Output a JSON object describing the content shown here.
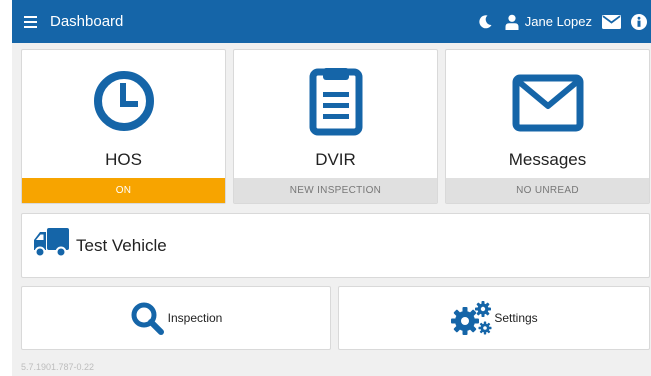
{
  "header": {
    "title": "Dashboard",
    "user_name": "Jane Lopez",
    "icons": [
      "menu-icon",
      "moon-icon",
      "user-icon",
      "mail-icon",
      "info-icon"
    ],
    "bar_color": "#1565a8"
  },
  "tiles": {
    "hos": {
      "label": "HOS",
      "status": "ON",
      "icon": "clock-icon"
    },
    "dvir": {
      "label": "DVIR",
      "status": "NEW INSPECTION",
      "icon": "clipboard-icon"
    },
    "messages": {
      "label": "Messages",
      "status": "NO UNREAD",
      "icon": "envelope-icon"
    }
  },
  "vehicle": {
    "name": "Test Vehicle",
    "icon": "truck-icon"
  },
  "actions": {
    "inspection": {
      "label": "Inspection",
      "icon": "search-icon"
    },
    "settings": {
      "label": "Settings",
      "icon": "gears-icon"
    }
  },
  "footer": {
    "version": "5.7.1901.787-0.22"
  },
  "colors": {
    "accent": "#1565a8",
    "status_on": "#f7a400"
  }
}
